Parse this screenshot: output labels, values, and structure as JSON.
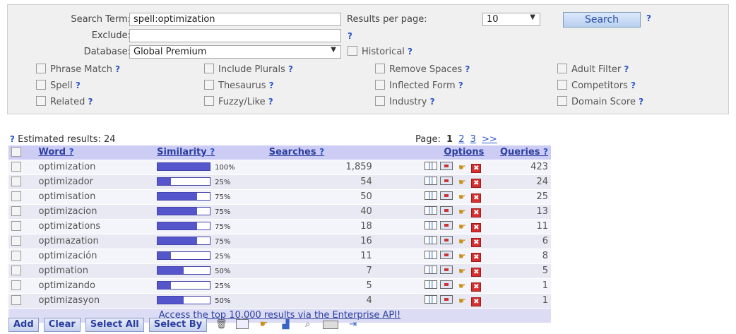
{
  "search": {
    "term_label": "Search Term:",
    "term_value": "spell:optimization",
    "exclude_label": "Exclude:",
    "exclude_value": "",
    "database_label": "Database:",
    "database_value": "Global Premium",
    "results_per_page_label": "Results per page:",
    "results_per_page_value": "10",
    "search_button": "Search",
    "historical_label": "Historical",
    "help": "?"
  },
  "options": [
    {
      "label": "Phrase Match"
    },
    {
      "label": "Include Plurals"
    },
    {
      "label": "Remove Spaces"
    },
    {
      "label": "Adult Filter"
    },
    {
      "label": "Spell"
    },
    {
      "label": "Thesaurus"
    },
    {
      "label": "Inflected Form"
    },
    {
      "label": "Competitors"
    },
    {
      "label": "Related"
    },
    {
      "label": "Fuzzy/Like"
    },
    {
      "label": "Industry"
    },
    {
      "label": "Domain Score"
    }
  ],
  "results_meta": {
    "estimated": "Estimated results: 24",
    "page_label": "Page:",
    "current_page": "1",
    "pages": [
      "2",
      "3",
      ">>"
    ]
  },
  "table": {
    "headers": {
      "word": "Word",
      "similarity": "Similarity",
      "searches": "Searches",
      "options": "Options",
      "queries": "Queries"
    },
    "rows": [
      {
        "word": "optimization",
        "similarity": 100,
        "similarity_label": "100%",
        "searches": "1,859",
        "queries": "423"
      },
      {
        "word": "optimizador",
        "similarity": 25,
        "similarity_label": "25%",
        "searches": "54",
        "queries": "24"
      },
      {
        "word": "optimisation",
        "similarity": 75,
        "similarity_label": "75%",
        "searches": "50",
        "queries": "25"
      },
      {
        "word": "optimizacion",
        "similarity": 75,
        "similarity_label": "75%",
        "searches": "40",
        "queries": "13"
      },
      {
        "word": "optimizations",
        "similarity": 75,
        "similarity_label": "75%",
        "searches": "18",
        "queries": "11"
      },
      {
        "word": "optimazation",
        "similarity": 75,
        "similarity_label": "75%",
        "searches": "16",
        "queries": "6"
      },
      {
        "word": "optimización",
        "similarity": 25,
        "similarity_label": "25%",
        "searches": "11",
        "queries": "8"
      },
      {
        "word": "optimation",
        "similarity": 50,
        "similarity_label": "50%",
        "searches": "7",
        "queries": "5"
      },
      {
        "word": "optimizando",
        "similarity": 25,
        "similarity_label": "25%",
        "searches": "5",
        "queries": "1"
      },
      {
        "word": "optimizasyon",
        "similarity": 50,
        "similarity_label": "50%",
        "searches": "4",
        "queries": "1"
      }
    ],
    "api_link": "Access the top 10,000 results via the Enterprise API!"
  },
  "toolbar": {
    "add": "Add",
    "clear": "Clear",
    "select_all": "Select All",
    "select_by": "Select By"
  },
  "icons": [
    "chart-icon",
    "window-icon",
    "pointer-icon",
    "delete-icon",
    "trash-icon",
    "binoculars-icon",
    "export-icon"
  ]
}
